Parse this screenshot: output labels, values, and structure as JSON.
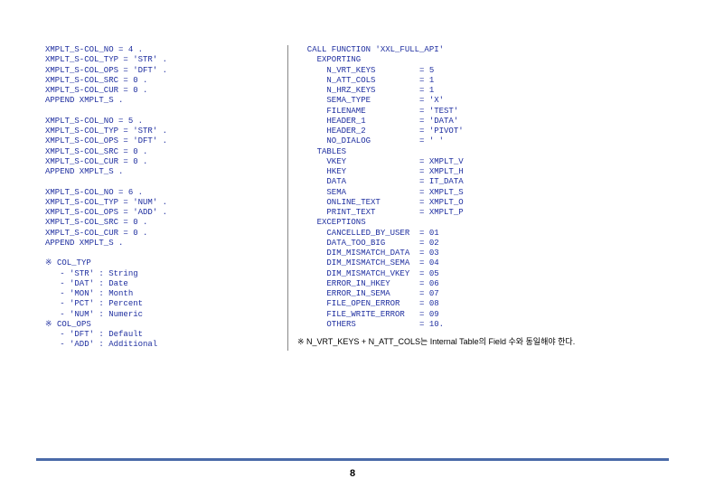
{
  "page_number": "8",
  "left": {
    "block4": [
      "XMPLT_S-COL_NO = 4 .",
      "XMPLT_S-COL_TYP = 'STR' .",
      "XMPLT_S-COL_OPS = 'DFT' .",
      "XMPLT_S-COL_SRC = 0 .",
      "XMPLT_S-COL_CUR = 0 .",
      "APPEND XMPLT_S ."
    ],
    "block5": [
      "XMPLT_S-COL_NO = 5 .",
      "XMPLT_S-COL_TYP = 'STR' .",
      "XMPLT_S-COL_OPS = 'DFT' .",
      "XMPLT_S-COL_SRC = 0 .",
      "XMPLT_S-COL_CUR = 0 .",
      "APPEND XMPLT_S ."
    ],
    "block6": [
      "XMPLT_S-COL_NO = 6 .",
      "XMPLT_S-COL_TYP = 'NUM' .",
      "XMPLT_S-COL_OPS = 'ADD' .",
      "XMPLT_S-COL_SRC = 0 .",
      "XMPLT_S-COL_CUR = 0 .",
      "APPEND XMPLT_S ."
    ],
    "legend_typ": [
      "※ COL_TYP",
      "   - 'STR' : String",
      "   - 'DAT' : Date",
      "   - 'MON' : Month",
      "   - 'PCT' : Percent",
      "   - 'NUM' : Numeric"
    ],
    "legend_ops": [
      "※ COL_OPS",
      "   - 'DFT' : Default",
      "   - 'ADD' : Additional"
    ]
  },
  "right": {
    "call": [
      "  CALL FUNCTION 'XXL_FULL_API'",
      "    EXPORTING",
      "      N_VRT_KEYS         = 5",
      "      N_ATT_COLS         = 1",
      "      N_HRZ_KEYS         = 1",
      "      SEMA_TYPE          = 'X'",
      "      FILENAME           = 'TEST'",
      "      HEADER_1           = 'DATA'",
      "      HEADER_2           = 'PIVOT'",
      "      NO_DIALOG          = ' '",
      "    TABLES",
      "      VKEY               = XMPLT_V",
      "      HKEY               = XMPLT_H",
      "      DATA               = IT_DATA",
      "      SEMA               = XMPLT_S",
      "      ONLINE_TEXT        = XMPLT_O",
      "      PRINT_TEXT         = XMPLT_P",
      "    EXCEPTIONS",
      "      CANCELLED_BY_USER  = 01",
      "      DATA_TOO_BIG       = 02",
      "      DIM_MISMATCH_DATA  = 03",
      "      DIM_MISMATCH_SEMA  = 04",
      "      DIM_MISMATCH_VKEY  = 05",
      "      ERROR_IN_HKEY      = 06",
      "      ERROR_IN_SEMA      = 07",
      "      FILE_OPEN_ERROR    = 08",
      "      FILE_WRITE_ERROR   = 09",
      "      OTHERS             = 10."
    ],
    "footnote": "※ N_VRT_KEYS + N_ATT_COLS는 Internal Table의 Field 수와 동일해야 한다."
  }
}
